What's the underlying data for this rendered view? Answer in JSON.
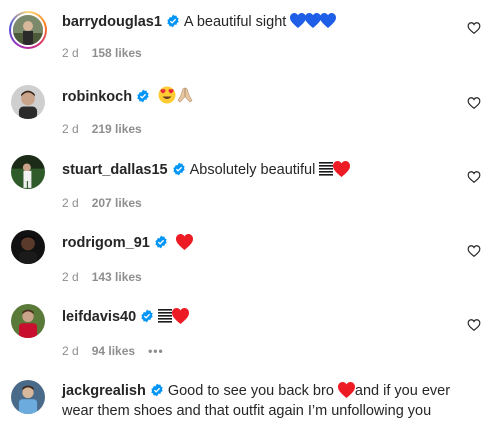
{
  "comments": [
    {
      "username": "barrydouglas1",
      "text": "A beautiful sight",
      "time": "2 d",
      "likes": "158 likes",
      "emoji": "blue-hearts",
      "story_ring": true
    },
    {
      "username": "robinkoch",
      "text": "",
      "time": "2 d",
      "likes": "219 likes",
      "emoji": "heart-eyes-praying"
    },
    {
      "username": "stuart_dallas15",
      "text": "Absolutely beautiful",
      "time": "2 d",
      "likes": "207 likes",
      "emoji": "flag-heart"
    },
    {
      "username": "rodrigom_91",
      "text": "",
      "time": "2 d",
      "likes": "143 likes",
      "emoji": "red-heart"
    },
    {
      "username": "leifdavis40",
      "text": "",
      "time": "2 d",
      "likes": "94 likes",
      "emoji": "flag-heart",
      "more": "•••"
    },
    {
      "username": "jackgrealish",
      "text_part1": "Good to see you back bro",
      "text_part2": "and if you ever wear them shoes and that outfit again I’m unfollowing you"
    }
  ],
  "colors": {
    "text": "#262626",
    "meta": "#8e8e8e",
    "verified": "#0095f6",
    "red_heart": "#ed1c24",
    "blue_heart": "#1f5fe8"
  },
  "icons": {
    "verified": "verified-badge-icon",
    "like": "heart-outline-icon"
  }
}
